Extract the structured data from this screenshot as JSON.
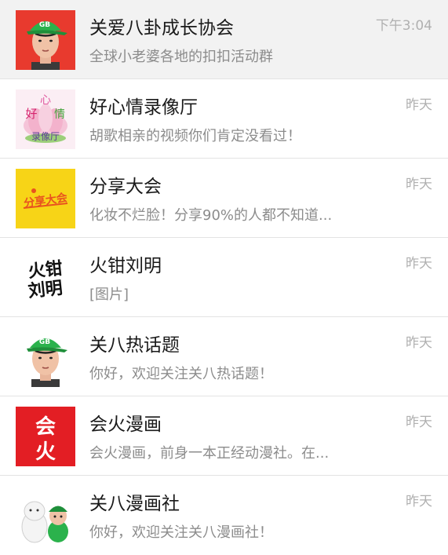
{
  "chats": [
    {
      "name": "关爱八卦成长协会",
      "preview": "全球小老婆各地的扣扣活动群",
      "time": "下午3:04",
      "avatar": "cap-man-red-avatar",
      "cap_text": "GB"
    },
    {
      "name": "好心情录像厅",
      "preview": "胡歌相亲的视频你们肯定没看过！",
      "time": "昨天",
      "avatar": "lotus-avatar",
      "avatar_text": {
        "hao": "好",
        "xin": "心",
        "qing": "情",
        "lu": "录像厅"
      }
    },
    {
      "name": "分享大会",
      "preview": "化妆不烂脸！分享90%的人都不知道...",
      "time": "昨天",
      "avatar": "yellow-logo-avatar",
      "avatar_text": "分享大会"
    },
    {
      "name": "火钳刘明",
      "preview": "[图片]",
      "time": "昨天",
      "avatar": "calligraphy-avatar",
      "avatar_text": "火钳刘明"
    },
    {
      "name": "关八热话题",
      "preview": "你好，欢迎关注关八热话题！",
      "time": "昨天",
      "avatar": "cap-man-avatar",
      "cap_text": "GB"
    },
    {
      "name": "会火漫画",
      "preview": "会火漫画，前身一本正经动漫社。在...",
      "time": "昨天",
      "avatar": "red-logo-avatar",
      "avatar_text": {
        "top": "会",
        "bottom": "火"
      }
    },
    {
      "name": "关八漫画社",
      "preview": "你好，欢迎关注关八漫画社！",
      "time": "昨天",
      "avatar": "cartoon-avatar"
    }
  ],
  "colors": {
    "active_row_bg": "#f2f2f2",
    "red_bg": "#e83a2e",
    "cap_green": "#2bb24c",
    "yellow_bg": "#f7d417",
    "title": "#1a1a1a",
    "preview": "#8c8c8c",
    "time": "#b0b0b0"
  }
}
